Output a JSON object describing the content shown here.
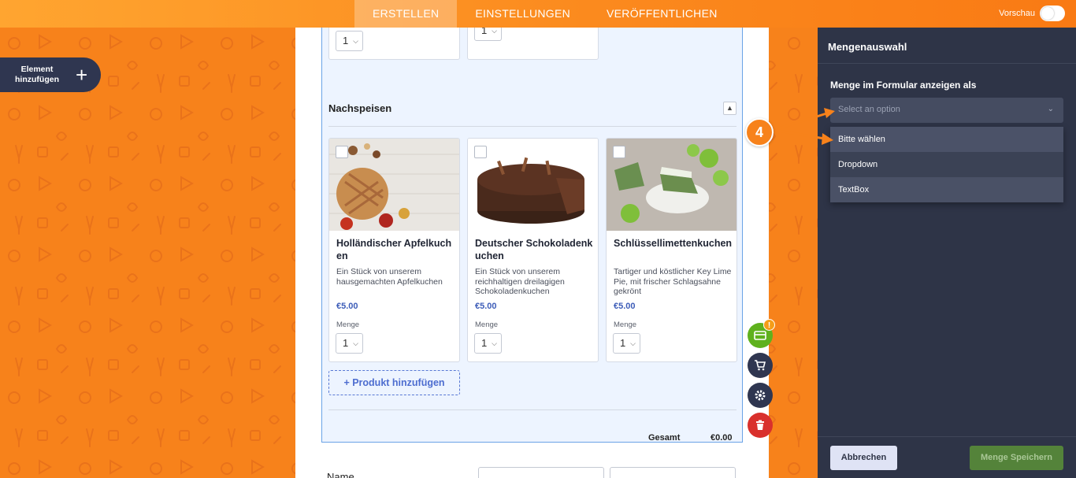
{
  "topbar": {
    "tabs": [
      "ERSTELLEN",
      "EINSTELLUNGEN",
      "VERÖFFENTLICHEN"
    ],
    "active_tab": "ERSTELLEN",
    "preview_label": "Vorschau"
  },
  "add_element": {
    "label_line1": "Element",
    "label_line2": "hinzufügen"
  },
  "form": {
    "top_qty_values": [
      "1",
      "1"
    ],
    "section_title": "Nachspeisen",
    "products": [
      {
        "name": "Holländischer Apfelkuchen",
        "description": "Ein Stück von unserem hausgemachten Apfelkuchen",
        "price": "€5.00",
        "qty_label": "Menge",
        "qty": "1"
      },
      {
        "name": "Deutscher Schokoladenkuchen",
        "description": "Ein Stück von unserem reichhaltigen dreilagigen Schokoladenkuchen",
        "price": "€5.00",
        "qty_label": "Menge",
        "qty": "1"
      },
      {
        "name": "Schlüssellimettenkuchen",
        "description": "Tartiger und köstlicher Key Lime Pie, mit frischer Schlagsahne gekrönt",
        "price": "€5.00",
        "qty_label": "Menge",
        "qty": "1"
      }
    ],
    "add_product_label": "+ Produkt hinzufügen",
    "total_label": "Gesamt",
    "total_value": "€0.00",
    "name_label": "Name"
  },
  "side_actions": {
    "badge": "!"
  },
  "panel": {
    "title": "Mengenauswahl",
    "field_label": "Menge im Formular anzeigen als",
    "select_placeholder": "Select an option",
    "options": [
      "Bitte wählen",
      "Dropdown",
      "TextBox"
    ],
    "cancel_label": "Abbrechen",
    "save_label": "Menge Speichern"
  },
  "annotation": {
    "step": "4"
  },
  "colors": {
    "orange": "#f7821b",
    "panel": "#2e3447",
    "accent_blue": "#4d6dd0",
    "save_green": "#54833a",
    "delete_red": "#d9302c",
    "payment_green": "#5fb11d"
  }
}
